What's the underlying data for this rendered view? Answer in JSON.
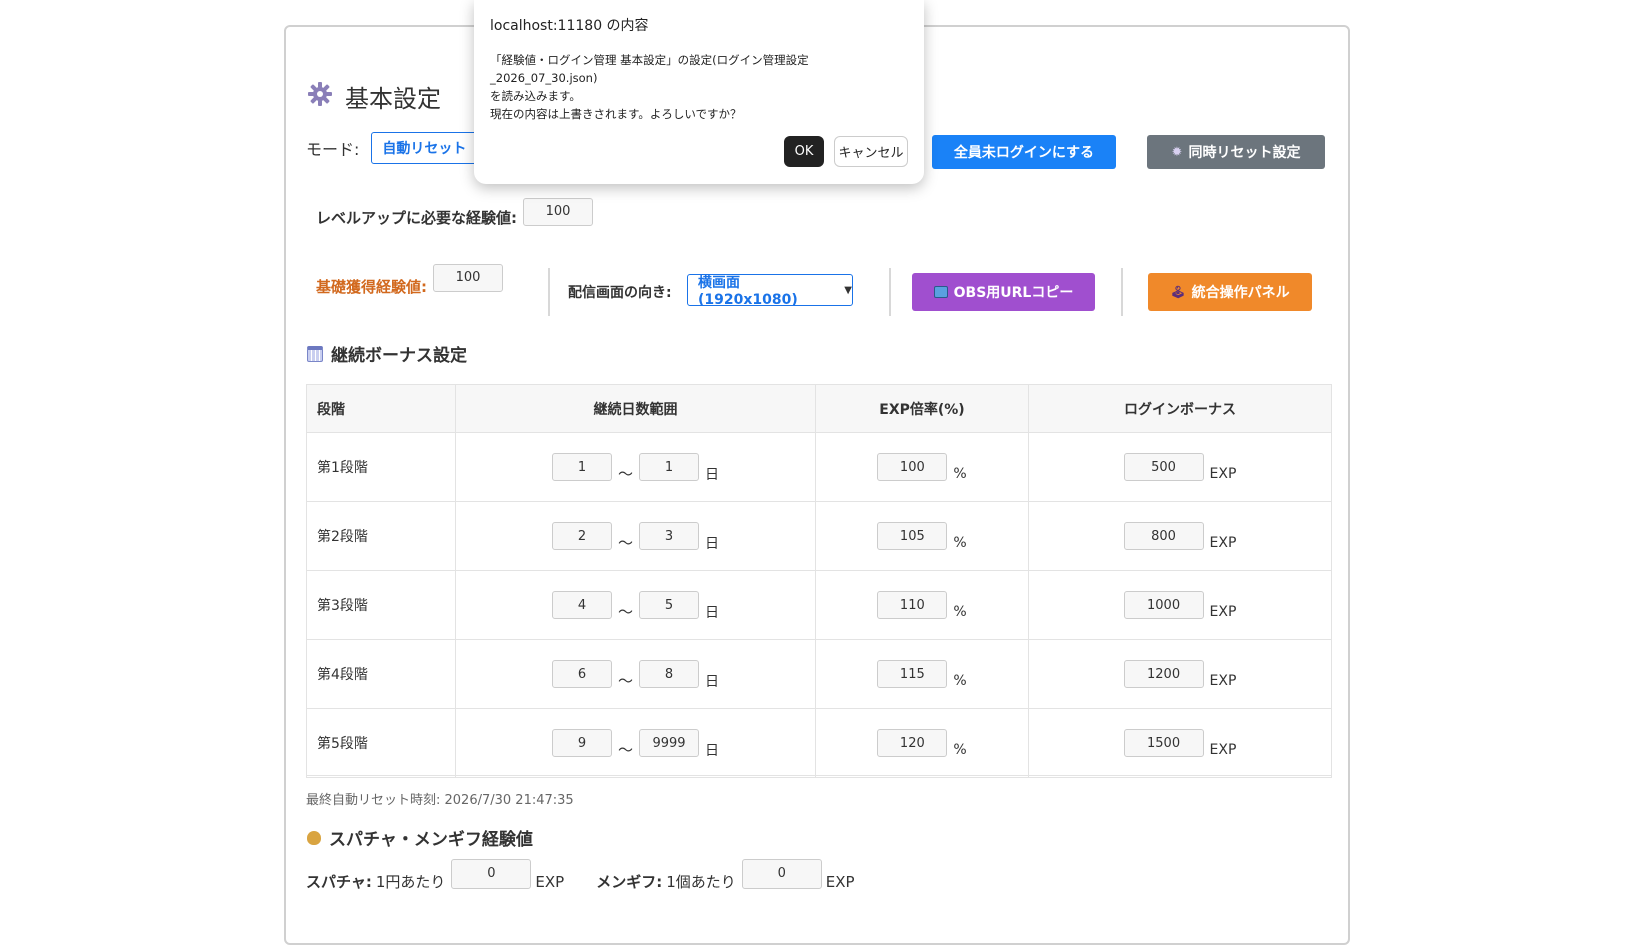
{
  "dialog": {
    "title": "localhost:11180 の内容",
    "message_line1": "「経験値・ログイン管理 基本設定」の設定(ログイン管理設定_2026_07_30.json)",
    "message_line2": "を読み込みます。",
    "message_line3": "現在の内容は上書きされます。よろしいですか？",
    "ok_label": "OK",
    "cancel_label": "キャンセル"
  },
  "header": {
    "title": "基本設定",
    "mode_label": "モード:",
    "mode_value": "自動リセット",
    "all_logout_button": "全員未ログインにする",
    "sync_reset_button": "同時リセット設定"
  },
  "level": {
    "label": "レベルアップに必要な経験値:",
    "value": "100"
  },
  "base": {
    "label": "基礎獲得経験値:",
    "value": "100",
    "orientation_label": "配信画面の向き:",
    "orientation_value": "横画面 (1920x1080)",
    "obs_button": "OBS用URLコピー",
    "panel_button": "統合操作パネル"
  },
  "bonus": {
    "heading": "継続ボーナス設定",
    "columns": [
      "段階",
      "継続日数範囲",
      "EXP倍率(%)",
      "ログインボーナス"
    ],
    "day_unit": "日",
    "tilde": "～",
    "percent_unit": "%",
    "exp_unit": "EXP",
    "rows": [
      {
        "stage": "第1段階",
        "from": "1",
        "to": "1",
        "rate": "100",
        "bonus": "500"
      },
      {
        "stage": "第2段階",
        "from": "2",
        "to": "3",
        "rate": "105",
        "bonus": "800"
      },
      {
        "stage": "第3段階",
        "from": "4",
        "to": "5",
        "rate": "110",
        "bonus": "1000"
      },
      {
        "stage": "第4段階",
        "from": "6",
        "to": "8",
        "rate": "115",
        "bonus": "1200"
      },
      {
        "stage": "第5段階",
        "from": "9",
        "to": "9999",
        "rate": "120",
        "bonus": "1500"
      }
    ]
  },
  "last_reset": "最終自動リセット時刻: 2026/7/30 21:47:35",
  "superchat": {
    "heading": "スパチャ・メンギフ経験値",
    "sp_label": "スパチャ:",
    "sp_per": "1円あたり",
    "sp_value": "0",
    "exp_unit": "EXP",
    "mg_label": "メンギフ:",
    "mg_per": "1個あたり",
    "mg_value": "0"
  },
  "icons": {
    "title_icon": "gear-icon",
    "sync_icon": "gear-icon",
    "obs_icon": "tv-icon",
    "panel_icon": "joystick-icon",
    "calendar_icon": "calendar-icon",
    "moneybag_icon": "money-bag-icon"
  }
}
